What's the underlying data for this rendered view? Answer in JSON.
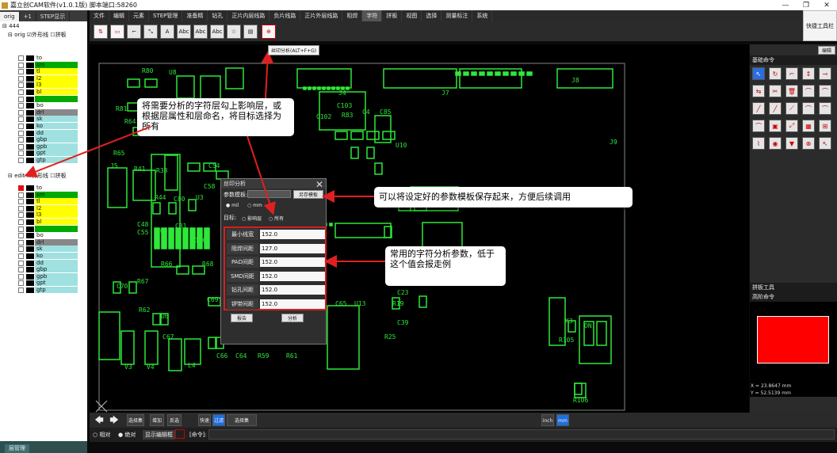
{
  "window": {
    "title": "嘉立创CAM软件(v1.0.1版) 脚本端口:58260",
    "minimize": "—",
    "maximize": "❐",
    "close": "✕"
  },
  "left_panel": {
    "tabs": [
      "orig",
      "+1",
      "STEP显示"
    ],
    "root": "444",
    "step1": {
      "name": "orig",
      "outline": "外形线",
      "panel": "拼板"
    },
    "step2": {
      "name": "edit",
      "outline": "外形线",
      "panel": "拼板"
    },
    "layers_orig": [
      {
        "name": "to",
        "color": "#ffffff"
      },
      {
        "name": "sm",
        "color": "#00aa00"
      },
      {
        "name": "tl",
        "color": "#ffff00"
      },
      {
        "name": "l2",
        "color": "#ffff00"
      },
      {
        "name": "l3",
        "color": "#ffff00"
      },
      {
        "name": "bl",
        "color": "#ffff00"
      },
      {
        "name": "",
        "color": "#00aa00"
      },
      {
        "name": "bo",
        "color": "#ffffff"
      },
      {
        "name": "drl",
        "color": "#888888"
      },
      {
        "name": "sk",
        "color": "#a0e0e0"
      },
      {
        "name": "ko",
        "color": "#a0e0e0"
      },
      {
        "name": "dd",
        "color": "#a0e0e0"
      },
      {
        "name": "gbp",
        "color": "#a0e0e0"
      },
      {
        "name": "gpb",
        "color": "#a0e0e0"
      },
      {
        "name": "gpt",
        "color": "#a0e0e0"
      },
      {
        "name": "gtp",
        "color": "#a0e0e0"
      }
    ],
    "layers_edit": [
      {
        "name": "to",
        "color": "#ffffff"
      },
      {
        "name": "sm",
        "color": "#00aa00"
      },
      {
        "name": "tl",
        "color": "#ffff00"
      },
      {
        "name": "l2",
        "color": "#ffff00"
      },
      {
        "name": "l3",
        "color": "#ffff00"
      },
      {
        "name": "bl",
        "color": "#ffff00"
      },
      {
        "name": "",
        "color": "#00aa00"
      },
      {
        "name": "bo",
        "color": "#ffffff"
      },
      {
        "name": "drl",
        "color": "#888888"
      },
      {
        "name": "sk",
        "color": "#a0e0e0"
      },
      {
        "name": "ko",
        "color": "#a0e0e0"
      },
      {
        "name": "dd",
        "color": "#a0e0e0"
      },
      {
        "name": "gbp",
        "color": "#a0e0e0"
      },
      {
        "name": "gpb",
        "color": "#a0e0e0"
      },
      {
        "name": "gpt",
        "color": "#a0e0e0"
      },
      {
        "name": "gtp",
        "color": "#a0e0e0"
      }
    ],
    "bottom_tab": "层管理"
  },
  "menu": [
    "文件",
    "编辑",
    "元素",
    "STEP管理",
    "准备精",
    "钻孔",
    "正片内层线路",
    "负片线路",
    "正片外层线路",
    "阻焊",
    "字符",
    "拼板",
    "视图",
    "选择",
    "测量标注",
    "系统"
  ],
  "menu_active_index": 10,
  "toolbar_icons": [
    "flip-icon",
    "edit-icon",
    "corner-icon",
    "resize-icon",
    "text-a-icon",
    "text-abc-icon",
    "text-abc-2-icon",
    "text-abc-3-icon",
    "star-icon",
    "report-icon",
    "silk-analysis-icon"
  ],
  "quick_tools_label": "快捷工具栏",
  "tooltip": "丝印分析(ALT+F+G)",
  "right_panel": {
    "edit_button": "编辑",
    "basic_commands": "基础命令",
    "panel_tools": "拼板工具",
    "advanced_commands": "高阶命令",
    "coord_x": "X = 23.8647 mm",
    "coord_y": "Y = 52.5139 mm"
  },
  "dialog": {
    "title": "丝印分析",
    "template_label": "参数模板:",
    "save_template": "另存模板",
    "unit_mil": "mil",
    "unit_mm": "mm",
    "target_label": "目标:",
    "target_affected": "影响层",
    "target_all": "所有",
    "params": [
      {
        "label": "最小线宽",
        "value": "152.0"
      },
      {
        "label": "阻焊间距",
        "value": "127.0"
      },
      {
        "label": "PAD间距",
        "value": "152.0"
      },
      {
        "label": "SMD间距",
        "value": "152.0"
      },
      {
        "label": "钻孔间距",
        "value": "152.0"
      },
      {
        "label": "锣带间距",
        "value": "152.0"
      }
    ],
    "report_button": "报告",
    "analyze_button": "分析"
  },
  "callouts": {
    "c1": "将需要分析的字符层勾上影响层，或根据层属性和层命名，将目标选择为所有",
    "c2": "可以将设定好的参数模板保存起来，方便后续调用",
    "c3": "常用的字符分析参数，低于这个值会报走例"
  },
  "bottom_toolbar": {
    "select_set": "选择集",
    "add": "增加",
    "reverse": "反选",
    "fast": "快速",
    "filter": "过滤",
    "select_dcode": "选择集dcode",
    "unit_inch": "inch",
    "unit_mm": "mm"
  },
  "status": {
    "relative": "相对",
    "absolute": "绝对",
    "display_ctrl": "显示编辑框",
    "command": "[命令]:"
  },
  "pcb_labels": [
    "R80",
    "U8",
    "J4",
    "J7",
    "J8",
    "R81",
    "R64",
    "C103",
    "C4",
    "C85",
    "R83",
    "C102",
    "U10",
    "R65",
    "J5",
    "R41",
    "R38",
    "C54",
    "C58",
    "J9",
    "R44",
    "C80",
    "U3",
    "C48",
    "C55",
    "C81",
    "R63",
    "R120",
    "R66",
    "R68",
    "C70",
    "R67",
    "C69",
    "R62",
    "U6",
    "C67",
    "L4",
    "V3",
    "V4",
    "C66",
    "C64",
    "R59",
    "R61",
    "C65",
    "U13",
    "R19",
    "C23",
    "C39",
    "R25",
    "K3",
    "R105",
    "R106",
    "ON"
  ]
}
